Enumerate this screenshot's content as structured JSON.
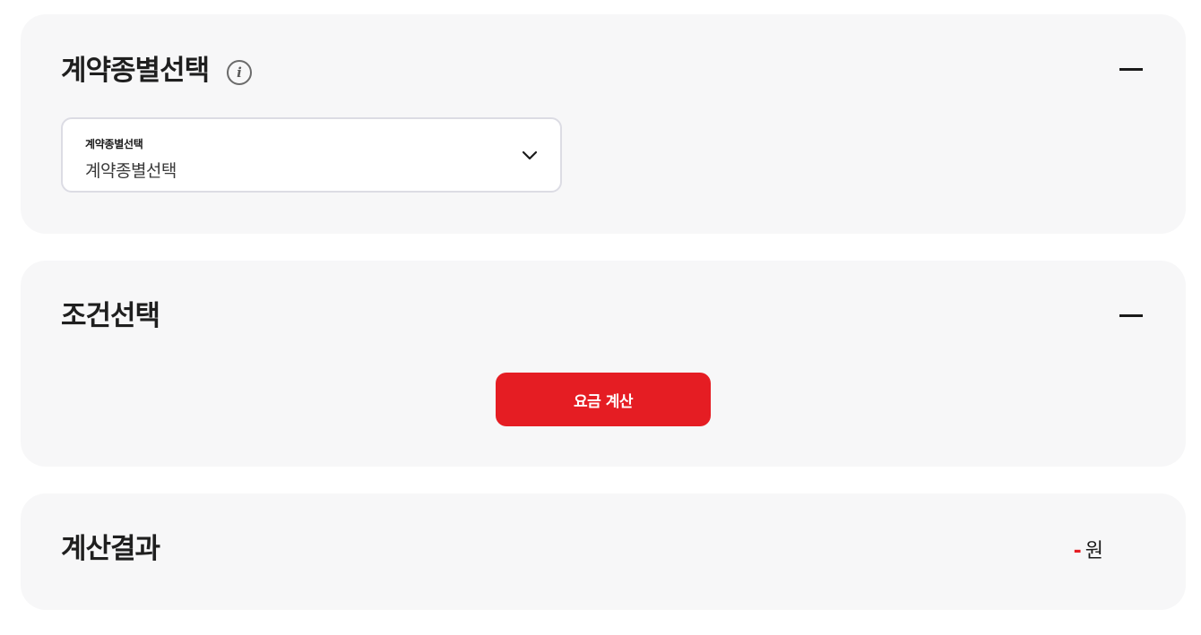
{
  "contract_section": {
    "title": "계약종별선택",
    "info_icon": "info-icon",
    "collapse_icon": "minus-icon",
    "select": {
      "label": "계약종별선택",
      "value": "계약종별선택",
      "icon": "chevron-down-icon"
    }
  },
  "condition_section": {
    "title": "조건선택",
    "collapse_icon": "minus-icon",
    "calculate_button": "요금 계산"
  },
  "result_section": {
    "title": "계산결과",
    "value": "-",
    "unit": "원"
  },
  "colors": {
    "accent": "#e51d23",
    "card_background": "#f7f7f8",
    "border": "#dcdce4"
  }
}
